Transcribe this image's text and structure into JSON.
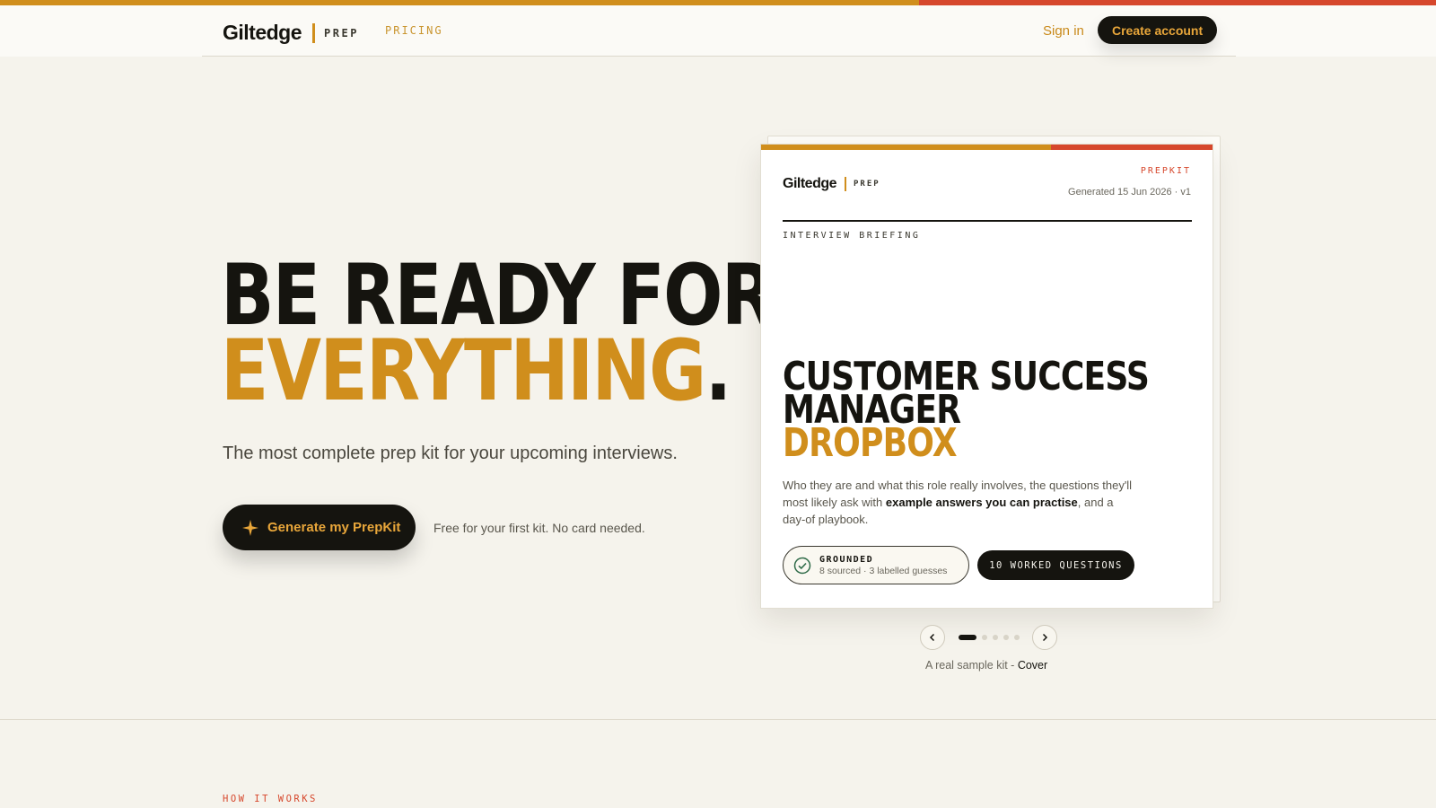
{
  "header": {
    "brand": "Giltedge",
    "brand_sub": "PREP",
    "nav_pricing": "PRICING",
    "sign_in": "Sign in",
    "create_account": "Create account"
  },
  "hero": {
    "title_line1": "BE READY FOR",
    "title_line2": "EVERYTHING",
    "title_dot": ".",
    "subtitle": "The most complete prep kit for your upcoming interviews.",
    "cta_label": "Generate my PrepKit",
    "cta_icon": "sparkle-icon",
    "free_note": "Free for your first kit. No card needed."
  },
  "sample_card": {
    "brand": "Giltedge",
    "brand_sub": "PREP",
    "kit_label": "PREPKIT",
    "generated": "Generated 15 Jun 2026 · v1",
    "briefing_label": "INTERVIEW BRIEFING",
    "role_line1": "CUSTOMER SUCCESS",
    "role_line2": "MANAGER",
    "company": "DROPBOX",
    "desc_part1": "Who they are and what this role really involves, the questions they'll most likely ask with ",
    "desc_bold": "example answers you can practise",
    "desc_part2": ", and a day-of playbook.",
    "grounded_title": "GROUNDED",
    "grounded_sub": "8 sourced · 3 labelled guesses",
    "worked_label": "10 WORKED QUESTIONS"
  },
  "carousel": {
    "prev_icon": "chevron-left-icon",
    "next_icon": "chevron-right-icon",
    "active_index": 1,
    "total": 5,
    "caption_prefix": "A real sample kit - ",
    "caption_page": "Cover"
  },
  "section": {
    "how_label": "HOW IT WORKS"
  },
  "colors": {
    "gold": "#d08e1c",
    "red": "#d6472c",
    "ink": "#15140f",
    "paper": "#f5f3ec"
  }
}
